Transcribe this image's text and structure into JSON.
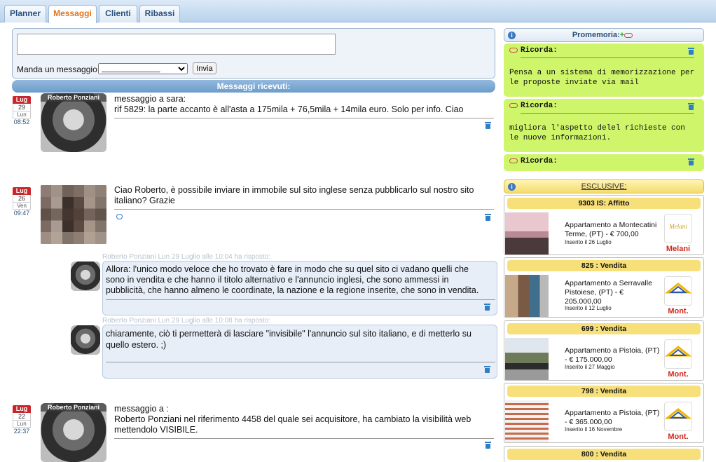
{
  "tabs": [
    {
      "label": "Planner"
    },
    {
      "label": "Messaggi"
    },
    {
      "label": "Clienti"
    },
    {
      "label": "Ribassi"
    }
  ],
  "compose": {
    "label": "Manda un messaggio a",
    "select_value": "_______________",
    "send_label": "Invia",
    "textarea_value": ""
  },
  "received_title": "Messaggi ricevuti:",
  "messages": [
    {
      "cal_month": "Lug",
      "cal_day": "29",
      "cal_weekday": "Lun",
      "cal_time": "08:52",
      "avatar_name": "Roberto Ponziani",
      "line1": "messaggio a sara:",
      "line2": "rif 5829: la parte accanto è all'asta a 175mila + 76,5mila + 14mila euro. Solo per info. Ciao"
    },
    {
      "cal_month": "Lug",
      "cal_day": "26",
      "cal_weekday": "Ven",
      "cal_time": "09:47",
      "line1": "Ciao Roberto, è possibile inviare in immobile sul sito inglese senza pubblicarlo sul nostro sito",
      "line2": "italiano? Grazie"
    },
    {
      "cal_month": "Lug",
      "cal_day": "22",
      "cal_weekday": "Lun",
      "cal_time": "22:37",
      "avatar_name": "Roberto Ponziani",
      "line1": "messaggio a :",
      "line2": "Roberto Ponziani nel riferimento 4458 del quale sei acquisitore, ha cambiato la visibilità web",
      "line3": "mettendolo VISIBILE."
    }
  ],
  "replies": [
    {
      "header": "Roberto Ponziani Lun 29 Luglio alle 10:04 ha risposto:",
      "line1": "Allora: l'unico modo veloce che ho trovato è fare in modo che su quel sito ci vadano quelli che",
      "line2": "sono in vendita e che hanno il titolo alternativo e l'annuncio inglesi, che sono ammessi in",
      "line3": "pubblicità, che hanno almeno le coordinate, la nazione e la regione inserite, che sono in vendita."
    },
    {
      "header": "Roberto Ponziani Lun 29 Luglio alle 10:08 ha risposto:",
      "line1": "chiaramente, ciò ti permetterà di lasciare \"invisibile\" l'annuncio sul sito italiano, e di metterlo su",
      "line2": "quello estero. ;)"
    }
  ],
  "reminders": {
    "title": "Promemoria:",
    "add_symbol": "+",
    "items": [
      {
        "heading": "Ricorda:",
        "line1": "Pensa a un sistema di memorizzazione per",
        "line2": "le proposte inviate via mail"
      },
      {
        "heading": "Ricorda:",
        "line1": "migliora l'aspetto delel richieste con",
        "line2": "le nuove informazioni."
      },
      {
        "heading": "Ricorda:"
      }
    ]
  },
  "exclusive": {
    "title": "ESCLUSIVE:",
    "listings": [
      {
        "title": "9303 IS: Affitto",
        "desc1": "Appartamento a Montecatini",
        "desc2": "Terme, (PT) - € 700,00",
        "desc3": "",
        "inserted": "Inserito il 26 Luglio",
        "agency": "Melani",
        "logo_text": "Melani"
      },
      {
        "title": "825 : Vendita",
        "desc1": "Appartamento a Serravalle",
        "desc2": "Pistoiese, (PT) - €",
        "desc3": "205.000,00",
        "inserted": "Inserito il 12 Luglio",
        "agency": "Mont.",
        "logo_text": "Montecatini"
      },
      {
        "title": "699 : Vendita",
        "desc1": "Appartamento a Pistoia, (PT)",
        "desc2": "- € 175.000,00",
        "desc3": "",
        "inserted": "Inserito il 27 Maggio",
        "agency": "Mont.",
        "logo_text": "Montecatini"
      },
      {
        "title": "798 : Vendita",
        "desc1": "Appartamento a Pistoia, (PT)",
        "desc2": "- € 365.000,00",
        "desc3": "",
        "inserted": "Inserito il 16 Novembre",
        "agency": "Mont.",
        "logo_text": "Montecatini"
      },
      {
        "title": "800 : Vendita"
      }
    ]
  }
}
